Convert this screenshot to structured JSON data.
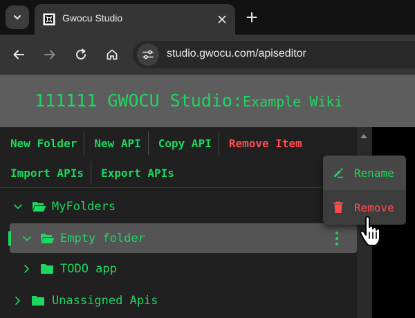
{
  "browser": {
    "tab_title": "Gwocu Studio",
    "url": "studio.gwocu.com/apiseditor"
  },
  "app": {
    "title_main": "111111 GWOCU Studio:",
    "title_sub": "Example Wiki",
    "accent_color": "#1ed760",
    "danger_color": "#ff4d4d"
  },
  "actions": {
    "new_folder": "New Folder",
    "new_api": "New API",
    "copy_api": "Copy API",
    "remove_item": "Remove Item",
    "import_apis": "Import APIs",
    "export_apis": "Export APIs"
  },
  "tree": {
    "items": [
      {
        "label": "MyFolders",
        "expanded": true,
        "icon": "folder-open-icon"
      },
      {
        "label": "Empty folder",
        "expanded": true,
        "selected": true,
        "icon": "folder-open-icon"
      },
      {
        "label": "TODO app",
        "expanded": false,
        "icon": "folder-icon"
      },
      {
        "label": "Unassigned Apis",
        "expanded": false,
        "icon": "folder-icon"
      }
    ]
  },
  "context_menu": {
    "rename": "Rename",
    "remove": "Remove"
  }
}
